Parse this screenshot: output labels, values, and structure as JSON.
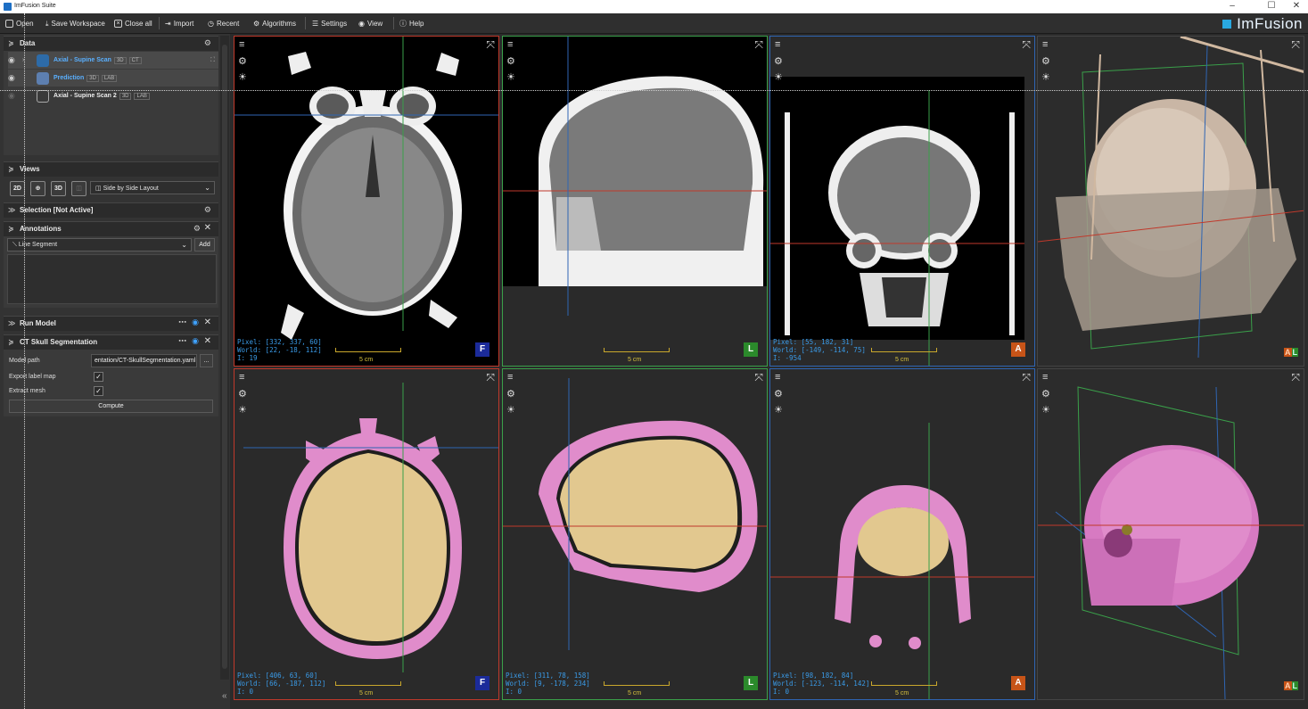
{
  "window": {
    "title": "ImFusion Suite",
    "controls": [
      "–",
      "☐",
      "✕"
    ]
  },
  "toolbar": {
    "items": [
      {
        "label": "Open",
        "icon": "folder-icon"
      },
      {
        "label": "Save Workspace",
        "icon": "download-icon"
      },
      {
        "label": "Close all",
        "icon": "close-all-icon"
      },
      {
        "label": "Import",
        "icon": "import-icon"
      },
      {
        "label": "Recent",
        "icon": "clock-icon"
      },
      {
        "label": "Algorithms",
        "icon": "algorithms-icon"
      },
      {
        "label": "Settings",
        "icon": "sliders-icon"
      },
      {
        "label": "View",
        "icon": "eye-icon"
      },
      {
        "label": "Help",
        "icon": "help-icon"
      }
    ],
    "logo": "ImFusion"
  },
  "panels": {
    "data": {
      "title": "Data",
      "items": [
        {
          "name": "Axial - Supine Scan",
          "tags": [
            "3D",
            "CT"
          ]
        },
        {
          "name": "Prediction",
          "tags": [
            "3D",
            "LAB"
          ]
        },
        {
          "name": "Axial - Supine Scan 2",
          "tags": [
            "3D",
            "LAB"
          ]
        }
      ]
    },
    "views": {
      "title": "Views",
      "buttons": [
        "2D",
        "⊕",
        "3D"
      ],
      "layout": "Side by Side Layout"
    },
    "selection": {
      "title": "Selection [Not Active]"
    },
    "annotations": {
      "title": "Annotations",
      "type": "Line Segment",
      "add": "Add"
    },
    "run_model": {
      "title": "Run Model"
    },
    "ct_skull": {
      "title": "CT Skull Segmentation",
      "model_path_label": "Model path",
      "model_path_value": "entation/CT-SkullSegmentation.yaml",
      "browse": "...",
      "export_label": "Export label map",
      "extract_label": "Extract mesh",
      "compute": "Compute"
    }
  },
  "viewports": {
    "scale": "5 cm",
    "ct_axial": {
      "pixel": "Pixel: [332, 337, 60]",
      "world": "World: [22, -18, 112]",
      "i": "I: 19",
      "orient": "F"
    },
    "ct_sagittal": {
      "orient": "L"
    },
    "ct_coronal": {
      "pixel": "Pixel: [55, 182, 31]",
      "world": "World: [-149, -114, 75]",
      "i": "I: -954",
      "orient": "A"
    },
    "ct_3d": {
      "orient_a": "A",
      "orient_l": "L"
    },
    "seg_axial": {
      "pixel": "Pixel: [406, 63, 60]",
      "world": "World: [66, -187, 112]",
      "i": "I: 0",
      "orient": "F"
    },
    "seg_sagittal": {
      "pixel": "Pixel: [311, 78, 158]",
      "world": "World: [9, -178, 234]",
      "i": "I: 0",
      "orient": "L"
    },
    "seg_coronal": {
      "pixel": "Pixel: [98, 182, 84]",
      "world": "World: [-123, -114, 142]",
      "i": "I: 0",
      "orient": "A"
    },
    "seg_3d": {
      "orient_a": "A",
      "orient_l": "L"
    }
  },
  "colors": {
    "accent": "#3a9be8",
    "brain": "#e2c88f",
    "skull_label": "#e08ccb",
    "red_frame": "#c0392b",
    "green_frame": "#3aa04a",
    "blue_frame": "#2f65b3",
    "orient_F": "#1b2b9a",
    "orient_L": "#2b8a2b",
    "orient_A": "#c75418"
  }
}
